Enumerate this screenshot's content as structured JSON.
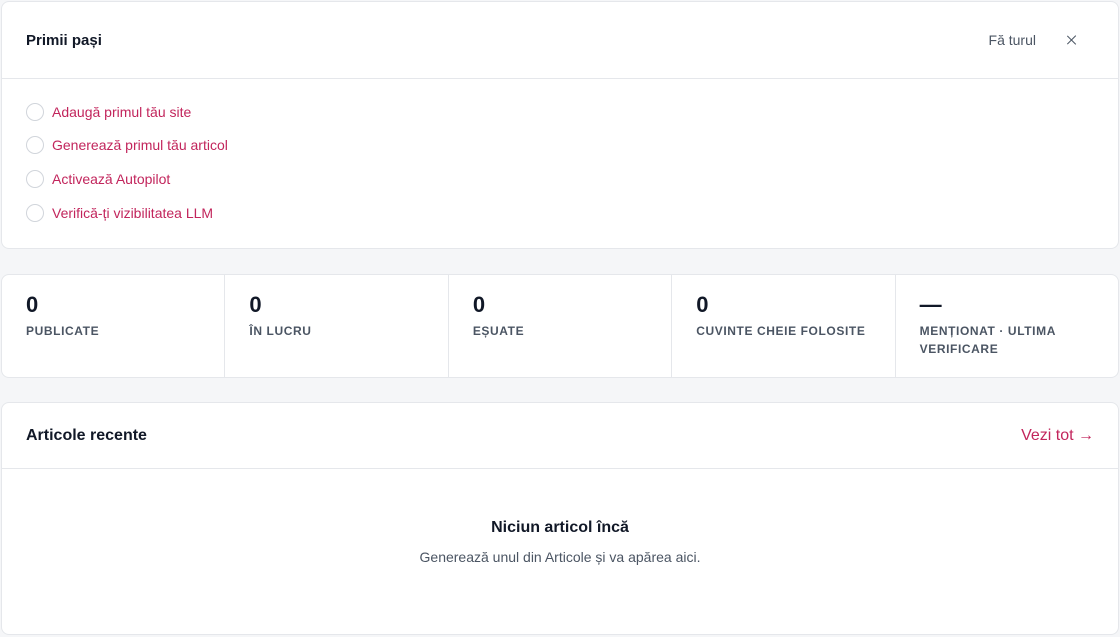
{
  "getting_started": {
    "title": "Primii pași",
    "tour_label": "Fă turul",
    "close_icon": "close-icon",
    "items": [
      {
        "label": "Adaugă primul tău site"
      },
      {
        "label": "Generează primul tău articol"
      },
      {
        "label": "Activează Autopilot"
      },
      {
        "label": "Verifică-ți vizibilitatea LLM"
      }
    ]
  },
  "stats": [
    {
      "value": "0",
      "label": "PUBLICATE"
    },
    {
      "value": "0",
      "label": "ÎN LUCRU"
    },
    {
      "value": "0",
      "label": "EȘUATE"
    },
    {
      "value": "0",
      "label": "CUVINTE CHEIE FOLOSITE"
    },
    {
      "value": "—",
      "label": "MENȚIONAT · ULTIMA VERIFICARE"
    }
  ],
  "recent_articles": {
    "title": "Articole recente",
    "see_all": "Vezi tot →",
    "empty_title": "Niciun articol încă",
    "empty_subtitle": "Generează unul din Articole și va apărea aici."
  },
  "colors": {
    "accent": "#c2255c",
    "text": "#111827",
    "muted": "#4b5563",
    "border": "#e5e7eb",
    "background": "#f5f6f8"
  }
}
